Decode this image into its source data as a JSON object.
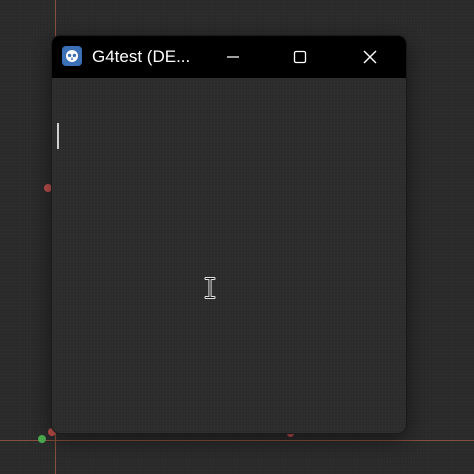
{
  "window": {
    "title": "G4test (DE...",
    "icon": "godot-engine-icon",
    "controls": {
      "minimize": "minimize-icon",
      "maximize": "maximize-icon",
      "close": "close-icon"
    }
  },
  "colors": {
    "titlebar": "#000000",
    "client_background": "#2b2b2b",
    "app_icon": "#3b6fb6",
    "guide_line": "#8a4f3c",
    "handle_red": "#c0504d",
    "handle_green": "#4caf50"
  }
}
